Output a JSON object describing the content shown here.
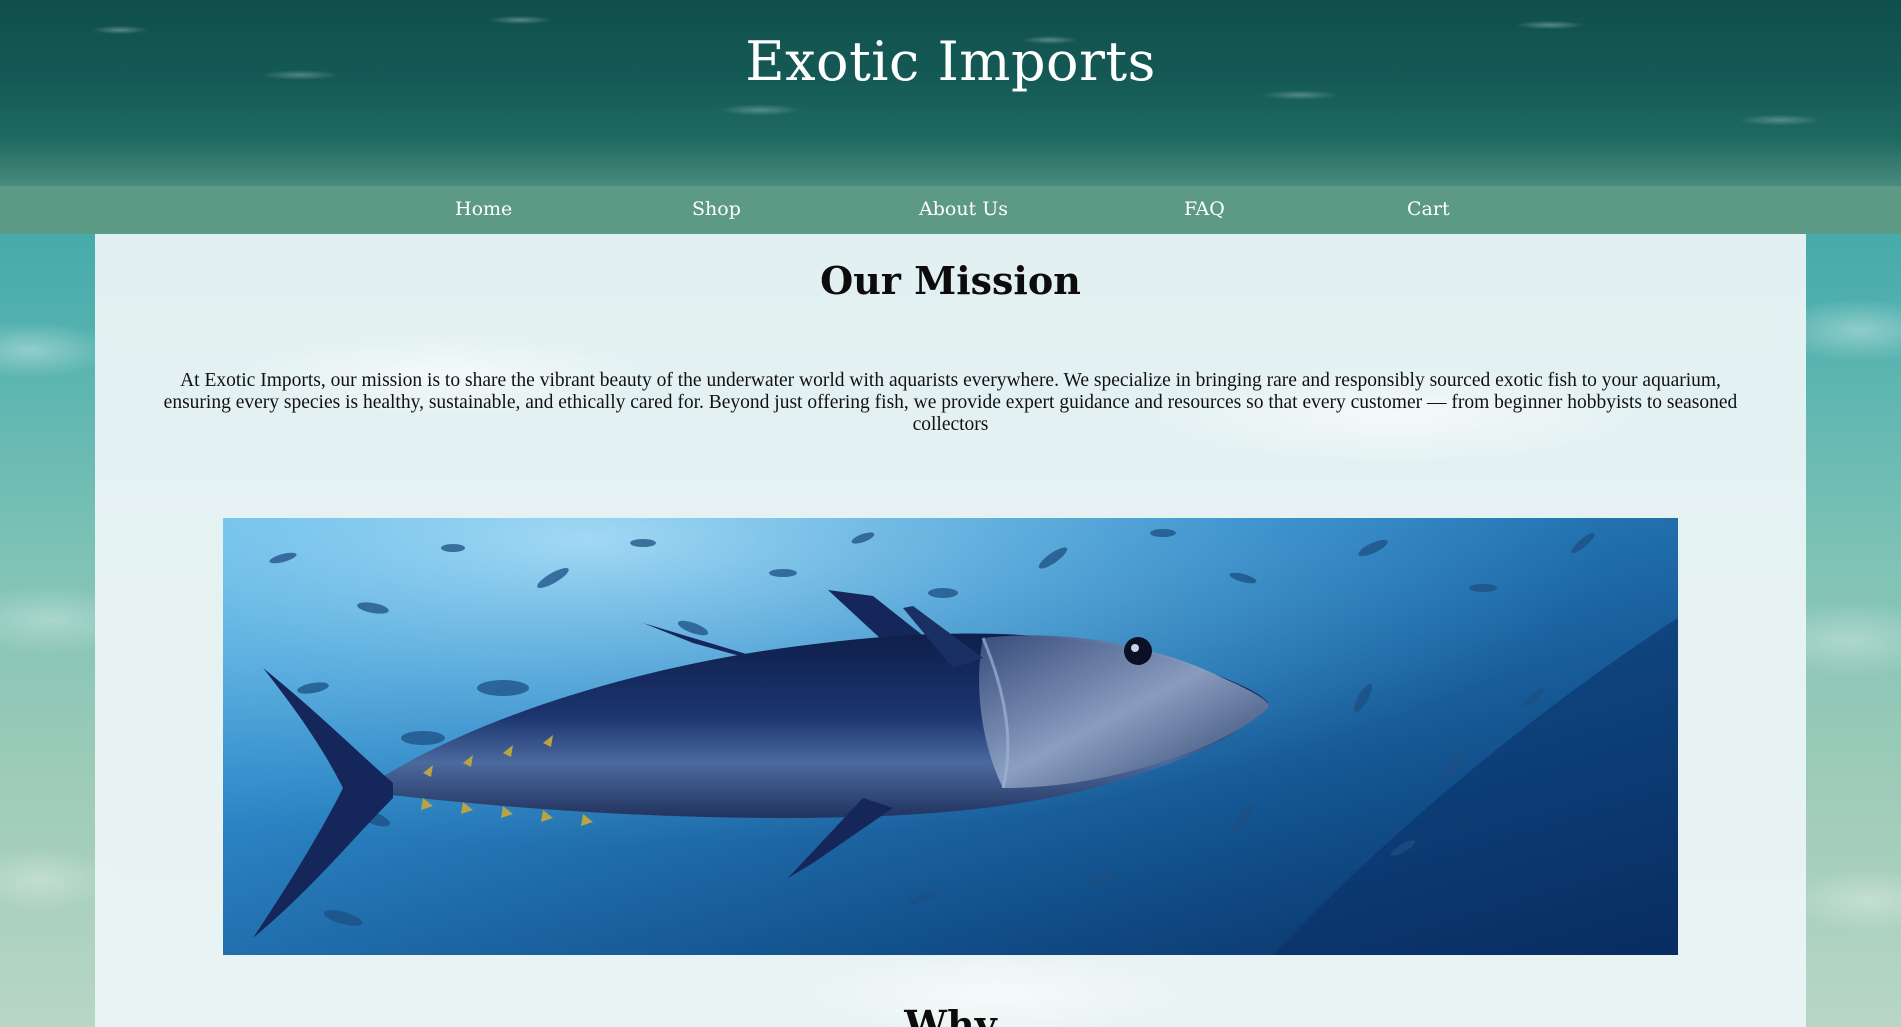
{
  "site": {
    "title": "Exotic Imports"
  },
  "nav": {
    "items": [
      {
        "label": "Home"
      },
      {
        "label": "Shop"
      },
      {
        "label": "About Us"
      },
      {
        "label": "FAQ"
      },
      {
        "label": "Cart"
      }
    ]
  },
  "mission": {
    "heading": "Our Mission",
    "body": "At Exotic Imports, our mission is to share the vibrant beauty of the underwater world with aquarists everywhere. We specialize in bringing rare and responsibly sourced exotic fish to your aquarium, ensuring every species is healthy, sustainable, and ethically cared for. Beyond just offering fish, we provide expert guidance and resources so that every customer — from beginner hobbyists to seasoned collectors",
    "next_heading": "Why"
  },
  "colors": {
    "header_dark": "#155a56",
    "nav_bar": "#5c9a86",
    "panel_bg": "#ecf4f5",
    "text": "#111111"
  }
}
